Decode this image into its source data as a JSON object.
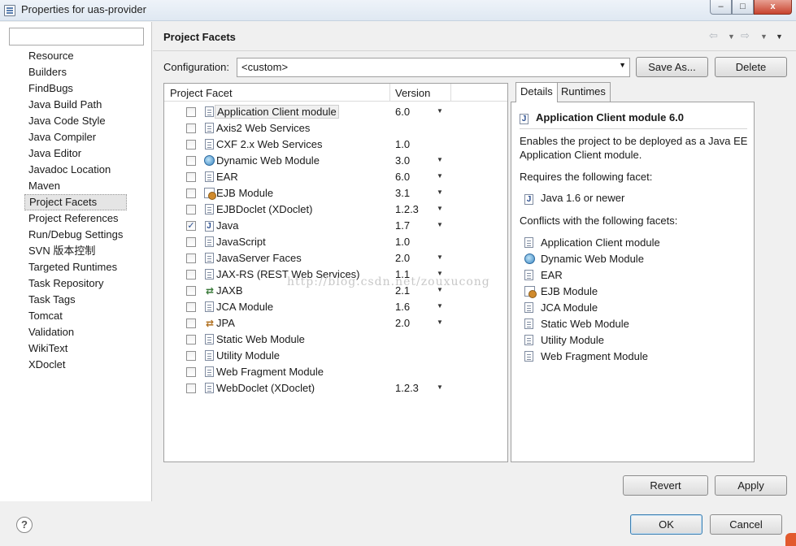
{
  "window": {
    "title": "Properties for uas-provider",
    "min_glyph": "–",
    "max_glyph": "□",
    "close_glyph": "x"
  },
  "nav": {
    "filter_placeholder": "",
    "items": [
      "Resource",
      "Builders",
      "FindBugs",
      "Java Build Path",
      "Java Code Style",
      "Java Compiler",
      "Java Editor",
      "Javadoc Location",
      "Maven",
      "Project Facets",
      "Project References",
      "Run/Debug Settings",
      "SVN 版本控制",
      "Targeted Runtimes",
      "Task Repository",
      "Task Tags",
      "Tomcat",
      "Validation",
      "WikiText",
      "XDoclet"
    ],
    "selected": "Project Facets"
  },
  "page": {
    "title": "Project Facets",
    "history": {
      "back_glyph": "⇦",
      "forward_glyph": "⇨",
      "dropdown_glyph": "▼"
    }
  },
  "config": {
    "label": "Configuration:",
    "value": "<custom>",
    "arrow": "▼",
    "save_as_label": "Save As...",
    "delete_label": "Delete"
  },
  "facets": {
    "col_facet": "Project Facet",
    "col_version": "Version",
    "rows": [
      {
        "name": "Application Client module",
        "version": "6.0",
        "dd": "▼",
        "checked": false,
        "icon": "doc-icon",
        "highlight": true
      },
      {
        "name": "Axis2 Web Services",
        "version": "",
        "dd": "",
        "checked": false,
        "icon": "doc-icon",
        "highlight": false
      },
      {
        "name": "CXF 2.x Web Services",
        "version": "1.0",
        "dd": "",
        "checked": false,
        "icon": "doc-icon",
        "highlight": false
      },
      {
        "name": "Dynamic Web Module",
        "version": "3.0",
        "dd": "▼",
        "checked": false,
        "icon": "globe-icon",
        "highlight": false
      },
      {
        "name": "EAR",
        "version": "6.0",
        "dd": "▼",
        "checked": false,
        "icon": "doc-icon",
        "highlight": false
      },
      {
        "name": "EJB Module",
        "version": "3.1",
        "dd": "▼",
        "checked": false,
        "icon": "bean-icon",
        "highlight": false
      },
      {
        "name": "EJBDoclet (XDoclet)",
        "version": "1.2.3",
        "dd": "▼",
        "checked": false,
        "icon": "doc-icon",
        "highlight": false
      },
      {
        "name": "Java",
        "version": "1.7",
        "dd": "▼",
        "checked": true,
        "icon": "java-icon",
        "highlight": false
      },
      {
        "name": "JavaScript",
        "version": "1.0",
        "dd": "",
        "checked": false,
        "icon": "doc-icon",
        "highlight": false
      },
      {
        "name": "JavaServer Faces",
        "version": "2.0",
        "dd": "▼",
        "checked": false,
        "icon": "doc-icon",
        "highlight": false
      },
      {
        "name": "JAX-RS (REST Web Services)",
        "version": "1.1",
        "dd": "▼",
        "checked": false,
        "icon": "doc-icon",
        "highlight": false
      },
      {
        "name": "JAXB",
        "version": "2.1",
        "dd": "▼",
        "checked": false,
        "icon": "jaxb-icon",
        "highlight": false
      },
      {
        "name": "JCA Module",
        "version": "1.6",
        "dd": "▼",
        "checked": false,
        "icon": "doc-icon",
        "highlight": false
      },
      {
        "name": "JPA",
        "version": "2.0",
        "dd": "▼",
        "checked": false,
        "icon": "jpa-icon",
        "highlight": false
      },
      {
        "name": "Static Web Module",
        "version": "",
        "dd": "",
        "checked": false,
        "icon": "doc-icon",
        "highlight": false
      },
      {
        "name": "Utility Module",
        "version": "",
        "dd": "",
        "checked": false,
        "icon": "doc-icon",
        "highlight": false
      },
      {
        "name": "Web Fragment Module",
        "version": "",
        "dd": "",
        "checked": false,
        "icon": "doc-icon",
        "highlight": false
      },
      {
        "name": "WebDoclet (XDoclet)",
        "version": "1.2.3",
        "dd": "▼",
        "checked": false,
        "icon": "doc-icon",
        "highlight": false
      }
    ]
  },
  "details": {
    "tabs": [
      "Details",
      "Runtimes"
    ],
    "active_tab": "Details",
    "title": "Application Client module 6.0",
    "description": "Enables the project to be deployed as a Java EE Application Client module.",
    "requires_label": "Requires the following facet:",
    "requires": {
      "name": "Java 1.6 or newer",
      "icon": "java-icon"
    },
    "conflicts_label": "Conflicts with the following facets:",
    "conflicts": [
      {
        "name": "Application Client module",
        "icon": "doc-icon"
      },
      {
        "name": "Dynamic Web Module",
        "icon": "globe-icon"
      },
      {
        "name": "EAR",
        "icon": "doc-icon"
      },
      {
        "name": "EJB Module",
        "icon": "bean-icon"
      },
      {
        "name": "JCA Module",
        "icon": "doc-icon"
      },
      {
        "name": "Static Web Module",
        "icon": "doc-icon"
      },
      {
        "name": "Utility Module",
        "icon": "doc-icon"
      },
      {
        "name": "Web Fragment Module",
        "icon": "doc-icon"
      }
    ]
  },
  "watermark": "http://blog.csdn.net/zouxucong",
  "footer": {
    "help_glyph": "?",
    "revert_label": "Revert",
    "apply_label": "Apply",
    "ok_label": "OK",
    "cancel_label": "Cancel"
  }
}
